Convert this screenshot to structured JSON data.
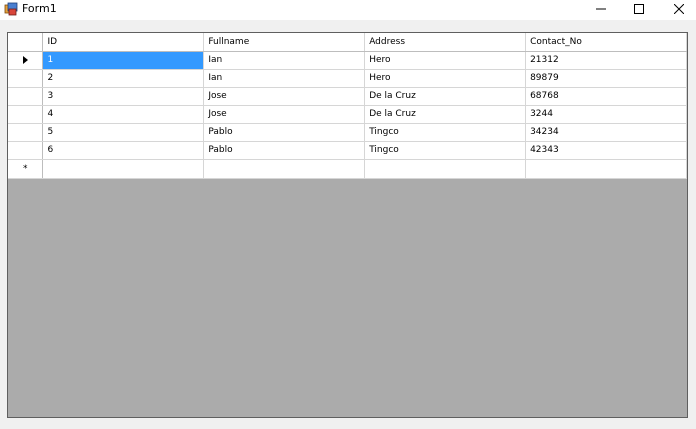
{
  "window": {
    "title": "Form1"
  },
  "controls": {
    "minimize": "—",
    "maximize": "☐",
    "close": "✕"
  },
  "grid": {
    "columns": [
      "ID",
      "Fullname",
      "Address",
      "Contact_No"
    ],
    "rows": [
      [
        "1",
        "Ian",
        "Hero",
        "21312"
      ],
      [
        "2",
        "Ian",
        "Hero",
        "89879"
      ],
      [
        "3",
        "Jose",
        "De la Cruz",
        "68768"
      ],
      [
        "4",
        "Jose",
        "De la Cruz",
        "3244"
      ],
      [
        "5",
        "Pablo",
        "Tingco",
        "34234"
      ],
      [
        "6",
        "Pablo",
        "Tingco",
        "42343"
      ]
    ],
    "new_row_marker": "*",
    "selected_row": 0,
    "selected_col": 0,
    "selection_color": "#3399ff"
  }
}
